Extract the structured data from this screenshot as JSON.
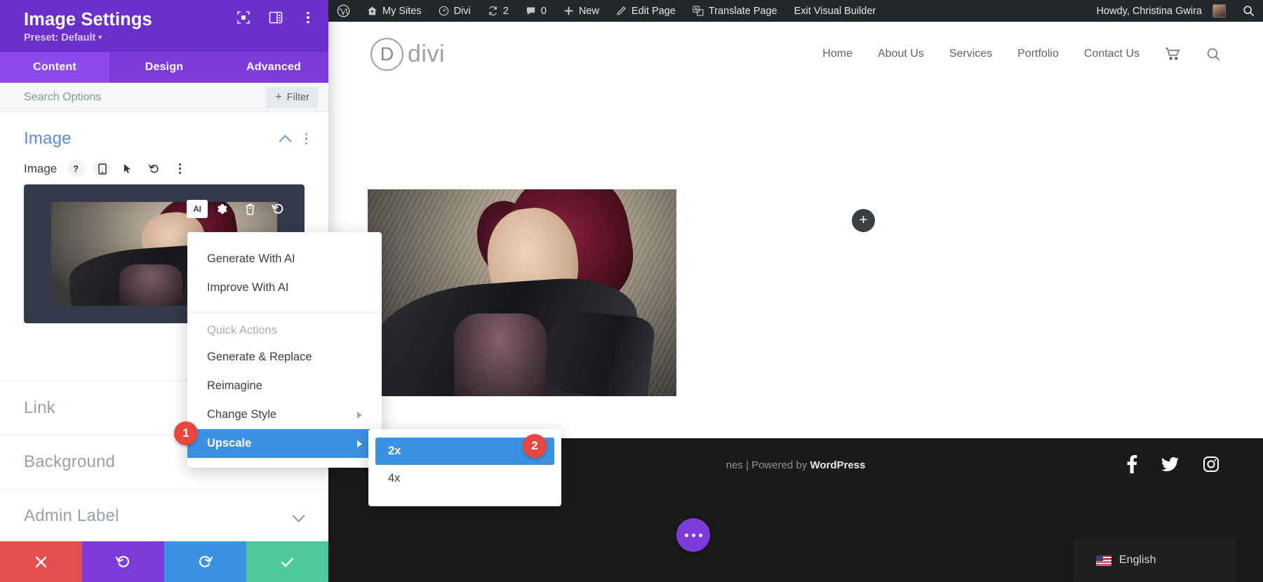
{
  "settings_panel": {
    "title": "Image Settings",
    "preset_label": "Preset: Default",
    "header_icons": [
      {
        "name": "focus-frame-icon"
      },
      {
        "name": "layout-panel-icon"
      },
      {
        "name": "kebab-menu-icon"
      }
    ],
    "tabs": [
      {
        "label": "Content",
        "active": true
      },
      {
        "label": "Design",
        "active": false
      },
      {
        "label": "Advanced",
        "active": false
      }
    ],
    "search": {
      "placeholder": "Search Options",
      "value": ""
    },
    "filter_button": {
      "label": "Filter",
      "plus": "+"
    },
    "section": {
      "title": "Image",
      "field_label": "Image",
      "field_icons": [
        "help-icon",
        "responsive-icon",
        "hover-icon",
        "reset-icon",
        "kebab-menu-icon"
      ]
    },
    "image_toolbar": [
      {
        "name": "ai-button",
        "label": "AI"
      },
      {
        "name": "settings-gear-icon"
      },
      {
        "name": "delete-trash-icon"
      },
      {
        "name": "undo-icon"
      }
    ],
    "collapsed_sections": [
      {
        "label": "Link",
        "expandable": false
      },
      {
        "label": "Background",
        "expandable": false
      },
      {
        "label": "Admin Label",
        "expandable": true
      }
    ],
    "footer_buttons": [
      {
        "name": "discard-button",
        "icon": "close-icon",
        "color": "#e44f4f"
      },
      {
        "name": "undo-button",
        "icon": "undo-icon",
        "color": "#7e3bdb"
      },
      {
        "name": "redo-button",
        "icon": "redo-icon",
        "color": "#3b92e0"
      },
      {
        "name": "save-button",
        "icon": "check-icon",
        "color": "#4fc99a"
      }
    ]
  },
  "ai_menu": {
    "items": [
      {
        "label": "Generate With AI",
        "type": "item"
      },
      {
        "label": "Improve With AI",
        "type": "item"
      }
    ],
    "group_label": "Quick Actions",
    "quick_actions": [
      {
        "label": "Generate & Replace",
        "submenu": false,
        "highlight": false
      },
      {
        "label": "Reimagine",
        "submenu": false,
        "highlight": false
      },
      {
        "label": "Change Style",
        "submenu": true,
        "highlight": false
      },
      {
        "label": "Upscale",
        "submenu": true,
        "highlight": true
      }
    ]
  },
  "upscale_submenu": {
    "options": [
      {
        "label": "2x",
        "highlight": true
      },
      {
        "label": "4x",
        "highlight": false
      }
    ]
  },
  "step_badges": [
    {
      "number": "1",
      "target": "upscale-menu-item"
    },
    {
      "number": "2",
      "target": "upscale-2x-option"
    }
  ],
  "wp_admin_bar": {
    "items": [
      {
        "label": "",
        "icon": "wordpress-logo-icon"
      },
      {
        "label": "My Sites",
        "icon": "sites-home-icon"
      },
      {
        "label": "Divi",
        "icon": "dashboard-icon"
      },
      {
        "label": "2",
        "icon": "updates-icon"
      },
      {
        "label": "0",
        "icon": "comments-icon"
      },
      {
        "label": "New",
        "icon": "plus-icon"
      },
      {
        "label": "Edit Page",
        "icon": "pencil-icon"
      },
      {
        "label": "Translate Page",
        "icon": "translate-icon"
      },
      {
        "label": "Exit Visual Builder",
        "icon": ""
      }
    ],
    "greeting": "Howdy, Christina Gwira",
    "search_icon": "search-icon"
  },
  "site": {
    "logo": {
      "mark": "D",
      "word": "divi"
    },
    "nav": [
      {
        "label": "Home"
      },
      {
        "label": "About Us"
      },
      {
        "label": "Services"
      },
      {
        "label": "Portfolio"
      },
      {
        "label": "Contact Us"
      }
    ],
    "nav_icons": [
      "cart-icon",
      "search-icon"
    ],
    "add_module_button": "+",
    "footer": {
      "credit_prefix": "nes",
      "separator": "|",
      "credit_middle": "Powered by ",
      "credit_brand": "WordPress",
      "social": [
        "facebook-icon",
        "twitter-icon",
        "instagram-icon"
      ]
    },
    "language_widget": {
      "label": "English",
      "flag": "us-flag-icon"
    }
  },
  "colors": {
    "panel_header_purple": "#6b30c9",
    "tab_purple": "#7e3bdb",
    "tab_active_purple": "#8e48ee",
    "highlight_blue": "#3b92e0",
    "badge_red": "#e8473f",
    "admin_bar_dark": "#23282d",
    "footer_dark": "#1a1a1a",
    "section_blue": "#5b8dd6"
  }
}
